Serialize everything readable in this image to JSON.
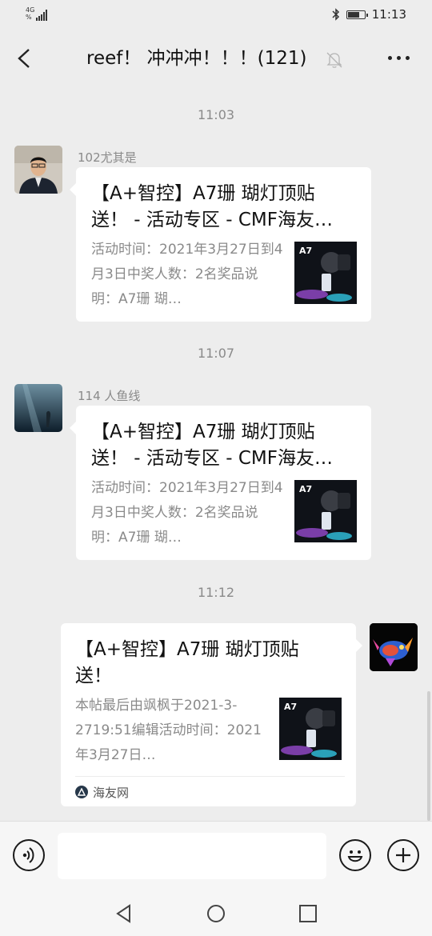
{
  "status_bar": {
    "network": "4G",
    "network_sub": "%",
    "time": "11:13",
    "icons": [
      "signal-icon",
      "bluetooth-icon",
      "battery-icon"
    ],
    "battery_level": 0.75
  },
  "header": {
    "title": "reef！ 冲冲冲！！！(121)",
    "icons": [
      "back-icon",
      "mute-bell-icon",
      "more-icon"
    ]
  },
  "messages": [
    {
      "time": "11:03",
      "sender": "102尤其是",
      "card": {
        "title": "【A+智控】A7珊 瑚灯顶贴送！ - 活动专区 - CMF海友…",
        "desc": "活动时间：2021年3月27日到4月3日中奖人数：2名奖品说明：A7珊 瑚…",
        "thumb_text": "A7"
      }
    },
    {
      "time": "11:07",
      "sender": "114 人鱼线",
      "card": {
        "title": "【A+智控】A7珊 瑚灯顶贴送！ - 活动专区 - CMF海友…",
        "desc": "活动时间：2021年3月27日到4月3日中奖人数：2名奖品说明：A7珊 瑚…",
        "thumb_text": "A7"
      }
    },
    {
      "time": "11:12",
      "card": {
        "title": "【A+智控】A7珊 瑚灯顶贴送！",
        "desc": "本帖最后由飒枫于2021-3-2719:51编辑活动时间：2021年3月27日…",
        "thumb_text": "A7",
        "source": "海友网"
      }
    }
  ],
  "input_bar": {
    "icons": [
      "voice-icon",
      "emoji-icon",
      "plus-icon"
    ]
  },
  "nav_bar": {
    "icons": [
      "nav-back-icon",
      "nav-home-icon",
      "nav-recent-icon"
    ]
  },
  "colors": {
    "background": "#ededed",
    "bubble": "#ffffff",
    "muted_text": "#8a8a8a"
  }
}
